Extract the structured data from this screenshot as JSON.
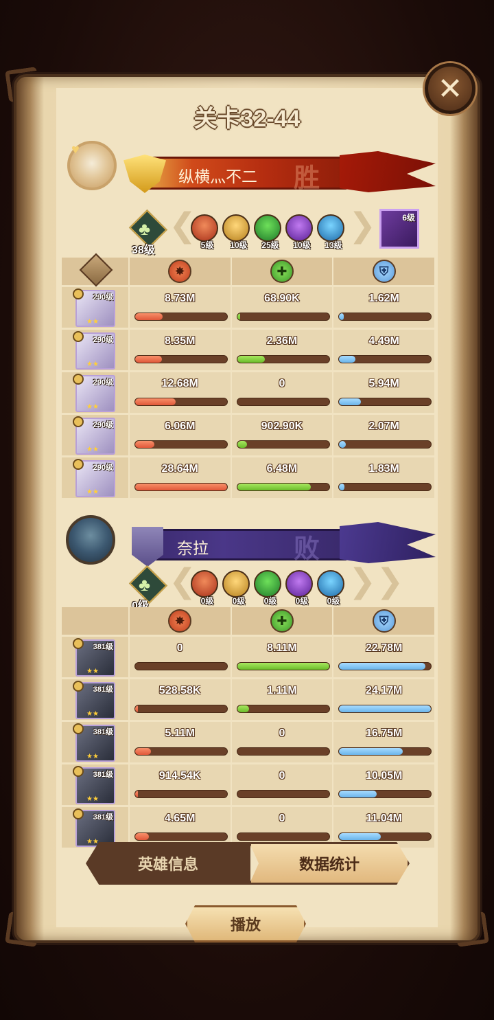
{
  "title": "关卡32-44",
  "close_icon": "close-icon",
  "winner": {
    "name": "纵横灬不二",
    "result": "胜",
    "tree_level": "38级",
    "factions": [
      "5级",
      "10级",
      "25级",
      "10级",
      "13级"
    ],
    "pet_level": "6级",
    "heroes": [
      {
        "level": "290级",
        "damage": "8.73M",
        "heal": "68.90K",
        "shield": "1.62M",
        "damage_pct": 0.3,
        "heal_pct": 0.02,
        "shield_pct": 0.05
      },
      {
        "level": "290级",
        "damage": "8.35M",
        "heal": "2.36M",
        "shield": "4.49M",
        "damage_pct": 0.29,
        "heal_pct": 0.3,
        "shield_pct": 0.18
      },
      {
        "level": "290级",
        "damage": "12.68M",
        "heal": "0",
        "shield": "5.94M",
        "damage_pct": 0.44,
        "heal_pct": 0.0,
        "shield_pct": 0.24
      },
      {
        "level": "290级",
        "damage": "6.06M",
        "heal": "902.90K",
        "shield": "2.07M",
        "damage_pct": 0.21,
        "heal_pct": 0.11,
        "shield_pct": 0.07
      },
      {
        "level": "290级",
        "damage": "28.64M",
        "heal": "6.48M",
        "shield": "1.83M",
        "damage_pct": 1.0,
        "heal_pct": 0.8,
        "shield_pct": 0.06
      }
    ]
  },
  "loser": {
    "name": "奈拉",
    "result": "败",
    "tree_level": "0级",
    "factions": [
      "0级",
      "0级",
      "0级",
      "0级",
      "0级"
    ],
    "heroes": [
      {
        "level": "381级",
        "damage": "0",
        "heal": "8.11M",
        "shield": "22.78M",
        "damage_pct": 0.0,
        "heal_pct": 1.0,
        "shield_pct": 0.94
      },
      {
        "level": "381级",
        "damage": "528.58K",
        "heal": "1.11M",
        "shield": "24.17M",
        "damage_pct": 0.02,
        "heal_pct": 0.13,
        "shield_pct": 1.0
      },
      {
        "level": "381级",
        "damage": "5.11M",
        "heal": "0",
        "shield": "16.75M",
        "damage_pct": 0.17,
        "heal_pct": 0.0,
        "shield_pct": 0.69
      },
      {
        "level": "381级",
        "damage": "914.54K",
        "heal": "0",
        "shield": "10.05M",
        "damage_pct": 0.03,
        "heal_pct": 0.0,
        "shield_pct": 0.41
      },
      {
        "level": "381级",
        "damage": "4.65M",
        "heal": "0",
        "shield": "11.04M",
        "damage_pct": 0.15,
        "heal_pct": 0.0,
        "shield_pct": 0.45
      }
    ]
  },
  "tabs": {
    "hero_info": "英雄信息",
    "stats": "数据统计"
  },
  "play_label": "播放"
}
